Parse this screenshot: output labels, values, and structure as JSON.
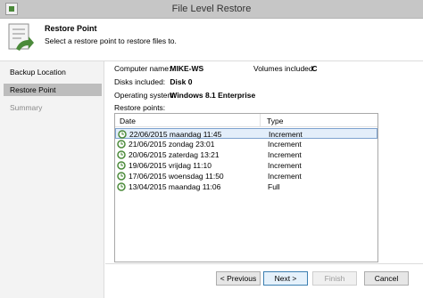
{
  "window": {
    "title": "File Level Restore"
  },
  "header": {
    "title": "Restore Point",
    "description": "Select a restore point to restore files to."
  },
  "nav": {
    "items": [
      {
        "label": "Backup Location",
        "state": "normal"
      },
      {
        "label": "Restore Point",
        "state": "active"
      },
      {
        "label": "Summary",
        "state": "disabled"
      }
    ]
  },
  "info": {
    "computer_name_label": "Computer name:",
    "computer_name": "MIKE-WS",
    "volumes_label": "Volumes included:",
    "volumes": "C",
    "disks_label": "Disks included:",
    "disks": "Disk 0",
    "os_label": "Operating system:",
    "os": "Windows 8.1 Enterprise",
    "restore_points_label": "Restore points:"
  },
  "grid": {
    "columns": [
      "Date",
      "Type"
    ],
    "rows": [
      {
        "date": "22/06/2015 maandag 11:45",
        "type": "Increment",
        "selected": true
      },
      {
        "date": "21/06/2015 zondag 23:01",
        "type": "Increment",
        "selected": false
      },
      {
        "date": "20/06/2015 zaterdag 13:21",
        "type": "Increment",
        "selected": false
      },
      {
        "date": "19/06/2015 vrijdag 11:10",
        "type": "Increment",
        "selected": false
      },
      {
        "date": "17/06/2015 woensdag 11:50",
        "type": "Increment",
        "selected": false
      },
      {
        "date": "13/04/2015 maandag 11:06",
        "type": "Full",
        "selected": false
      }
    ]
  },
  "buttons": {
    "previous": "< Previous",
    "next": "Next >",
    "finish": "Finish",
    "cancel": "Cancel"
  },
  "colors": {
    "selected_row": "#e3eefa",
    "active_nav": "#bdbdbd",
    "icon_green": "#4b8a3a"
  }
}
